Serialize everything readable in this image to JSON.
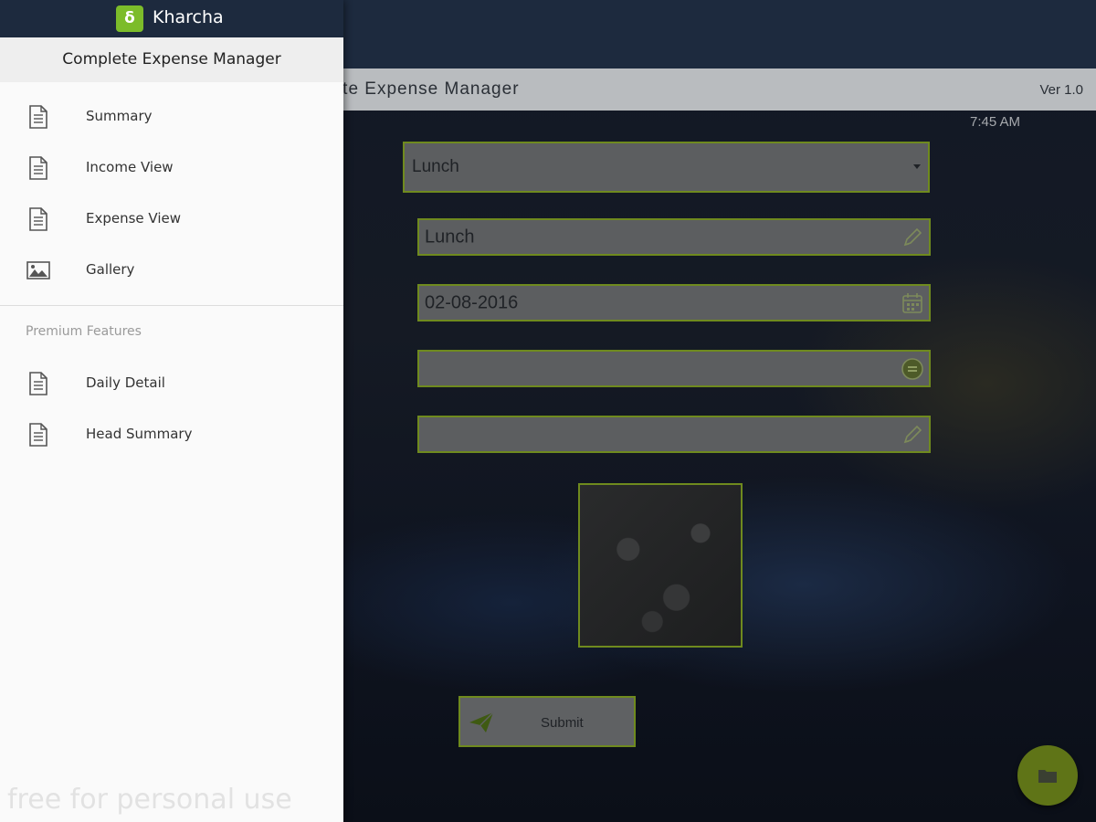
{
  "drawer": {
    "app_name": "Kharcha",
    "logo_glyph": "δ",
    "subtitle": "Complete Expense Manager",
    "items": [
      {
        "label": "Summary",
        "icon": "document-icon"
      },
      {
        "label": "Income View",
        "icon": "document-icon"
      },
      {
        "label": "Expense View",
        "icon": "document-icon"
      },
      {
        "label": "Gallery",
        "icon": "image-icon"
      }
    ],
    "premium_section_label": "Premium Features",
    "premium_items": [
      {
        "label": "Daily Detail",
        "icon": "document-icon"
      },
      {
        "label": "Head Summary",
        "icon": "document-icon"
      }
    ],
    "watermark": "free for personal use"
  },
  "app": {
    "header_title": "mplete Expense Manager",
    "version": "Ver 1.0",
    "time": "7:45 AM",
    "form": {
      "category_select": "Lunch",
      "name_value": "Lunch",
      "date_value": "02-08-2016",
      "amount_value": "",
      "note_value": ""
    },
    "submit_label": "Submit"
  },
  "colors": {
    "accent_border": "#6f8a1e",
    "drawer_header": "#1d2a3e",
    "logo_green": "#7cbc2a",
    "fab_green": "#5f7417"
  }
}
